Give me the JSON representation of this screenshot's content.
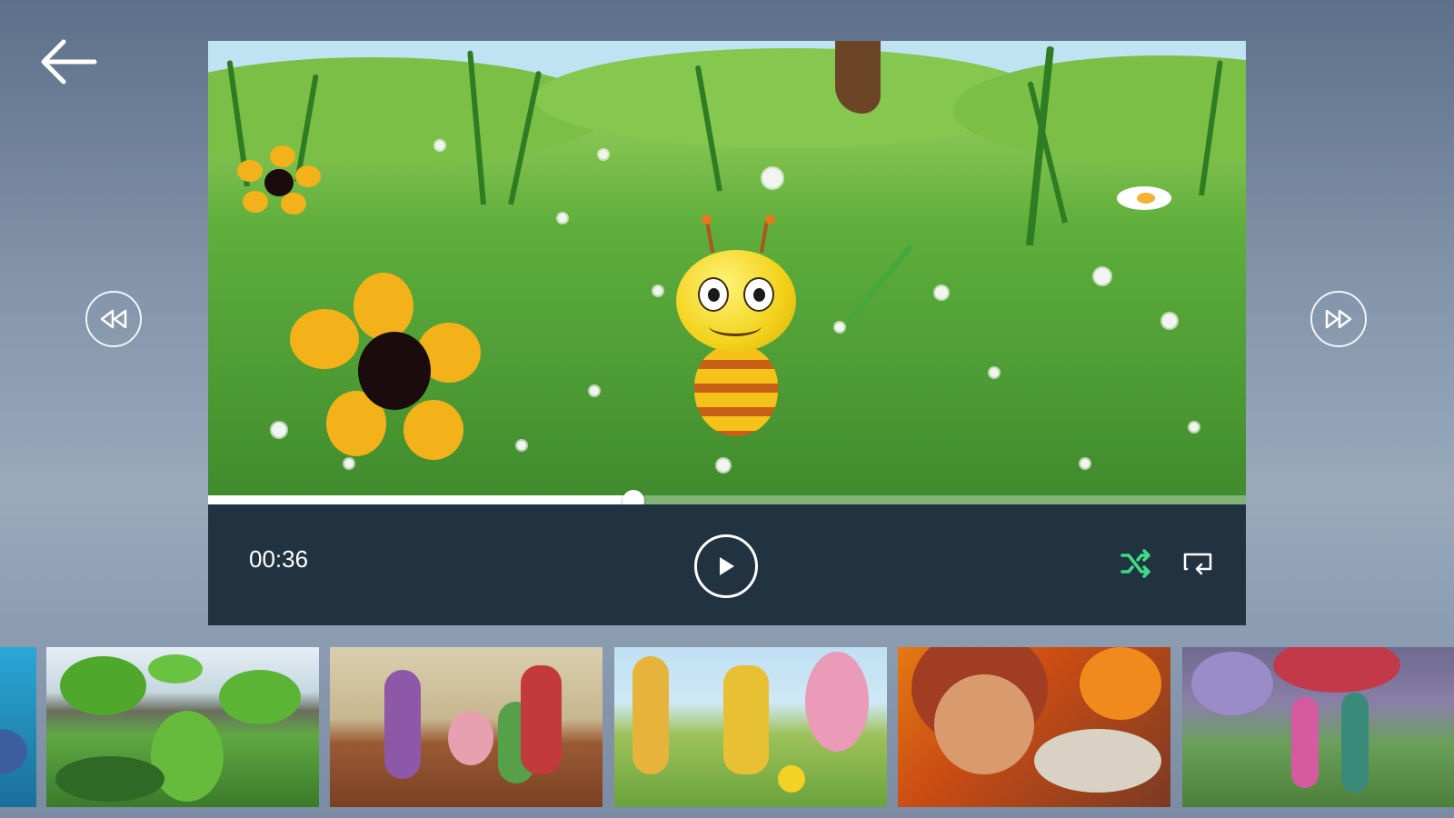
{
  "navigation": {
    "back_icon": "arrow-left-icon",
    "rewind_icon": "rewind-circle-icon",
    "forward_icon": "fast-forward-circle-icon"
  },
  "player": {
    "current_time": "00:36",
    "progress": 0.41,
    "play_icon": "play-icon",
    "shuffle_icon": "shuffle-icon",
    "repeat_icon": "repeat-icon",
    "shuffle_active": true,
    "colors": {
      "accent": "#3ddc84",
      "controls_bg": "#213340",
      "progress_fill": "#ffffff"
    }
  },
  "thumbnails": [
    {
      "scene": "underwater"
    },
    {
      "scene": "frog-with-guitar"
    },
    {
      "scene": "birthday-party"
    },
    {
      "scene": "farm-ducks-pig"
    },
    {
      "scene": "sleeping-baby"
    },
    {
      "scene": "rain-umbrella"
    }
  ]
}
